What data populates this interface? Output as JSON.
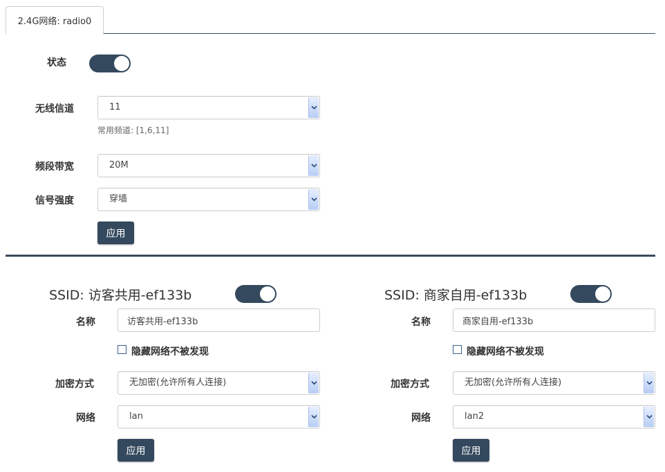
{
  "tabs": [
    {
      "label": "2.4G网络:  radio0"
    }
  ],
  "radio": {
    "status_label": "状态",
    "status_on": true,
    "channel_label": "无线信道",
    "channel_value": "11",
    "channel_help": "常用频道: [1,6,11]",
    "bandwidth_label": "频段带宽",
    "bandwidth_value": "20M",
    "power_label": "信号强度",
    "power_value": "穿墙",
    "apply_label": "应用"
  },
  "ssids": [
    {
      "title": "SSID: 访客共用-ef133b",
      "enabled": true,
      "name_label": "名称",
      "name_value": "访客共用-ef133b",
      "hide_label": "隐藏网络不被发现",
      "hide_checked": false,
      "encryption_label": "加密方式",
      "encryption_value": "无加密(允许所有人连接)",
      "network_label": "网络",
      "network_value": "lan",
      "apply_label": "应用"
    },
    {
      "title": "SSID: 商家自用-ef133b",
      "enabled": true,
      "name_label": "名称",
      "name_value": "商家自用-ef133b",
      "hide_label": "隐藏网络不被发现",
      "hide_checked": false,
      "encryption_label": "加密方式",
      "encryption_value": "无加密(允许所有人连接)",
      "network_label": "网络",
      "network_value": "lan2",
      "apply_label": "应用"
    }
  ],
  "colors": {
    "accent": "#34495e",
    "select_arrow": "#b8cdf5",
    "border": "#cccccc"
  },
  "icons": {
    "select_arrow": "chevron-down-icon",
    "toggle_knob": "toggle-knob"
  }
}
